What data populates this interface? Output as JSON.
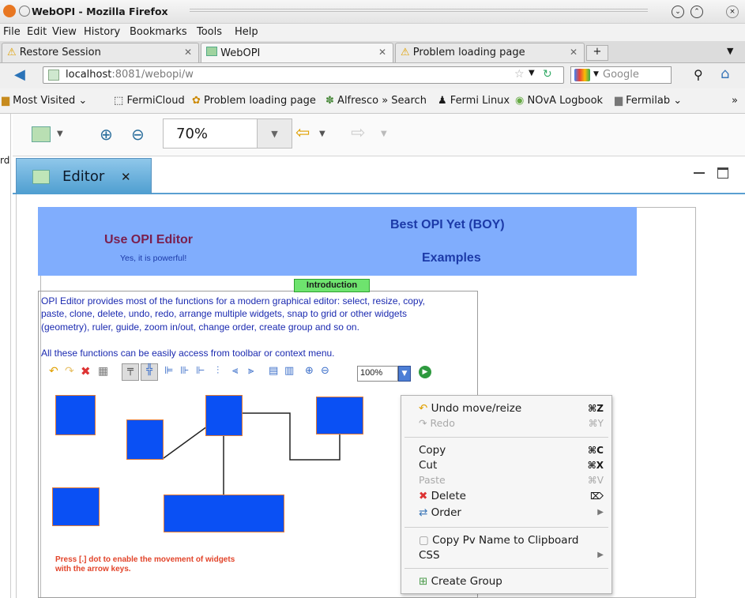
{
  "window": {
    "title": "WebOPI - Mozilla Firefox"
  },
  "menubar": [
    "File",
    "Edit",
    "View",
    "History",
    "Bookmarks",
    "Tools",
    "Help"
  ],
  "tabs": [
    {
      "label": "Restore Session",
      "icon": "warning-icon"
    },
    {
      "label": "WebOPI",
      "icon": "opi-icon"
    },
    {
      "label": "Problem loading page",
      "icon": "warning-icon"
    }
  ],
  "nav": {
    "url_host": "localhost",
    "url_rest": ":8081/webopi/w",
    "search_placeholder": "Google"
  },
  "bookmarks": [
    "Most Visited",
    "FermiCloud",
    "Problem loading page",
    "Alfresco » Search",
    "Fermi Linux",
    "NOvA Logbook",
    "Fermilab"
  ],
  "toolbar": {
    "zoom": "70%"
  },
  "editor_tab": {
    "label": "Editor"
  },
  "opi": {
    "banner_left_title": "Use OPI Editor",
    "banner_left_sub": "Yes, it is powerful!",
    "banner_right_title": "Best OPI Yet (BOY)",
    "banner_right_sub": "Examples",
    "intro_tag": "Introduction",
    "intro_lines": [
      "OPI Editor provides most of the functions for a modern graphical editor: select, resize, copy,",
      "paste, clone, delete, undo, redo, arrange multiple widgets, snap to grid or other widgets",
      "(geometry), ruler, guide, zoom in/out, change order, create group and so on.",
      "All these functions can be easily access from toolbar or context menu."
    ],
    "mini_zoom": "100%",
    "hint_line1": "Press [.] dot to enable the movement of widgets",
    "hint_line2": "with the arrow keys."
  },
  "context_menu": {
    "items": [
      {
        "label": "Undo move/reize",
        "shortcut": "⌘Z",
        "enabled": true
      },
      {
        "label": "Redo",
        "shortcut": "⌘Y",
        "enabled": false
      },
      {
        "label": "Copy",
        "shortcut": "⌘C",
        "enabled": true
      },
      {
        "label": "Cut",
        "shortcut": "⌘X",
        "enabled": true
      },
      {
        "label": "Paste",
        "shortcut": "⌘V",
        "enabled": false
      },
      {
        "label": "Delete",
        "shortcut": "⌦",
        "enabled": true
      },
      {
        "label": "Order",
        "shortcut": "▶",
        "enabled": true
      },
      {
        "label": "Copy Pv Name to Clipboard",
        "shortcut": "",
        "enabled": true
      },
      {
        "label": "CSS",
        "shortcut": "▶",
        "enabled": true
      },
      {
        "label": "Create Group",
        "shortcut": "",
        "enabled": true
      }
    ]
  },
  "colors": {
    "banner": "#80adfd",
    "widget": "#0a50f4",
    "widget_border": "#e37b34",
    "intro_tag": "#6ee36e"
  }
}
